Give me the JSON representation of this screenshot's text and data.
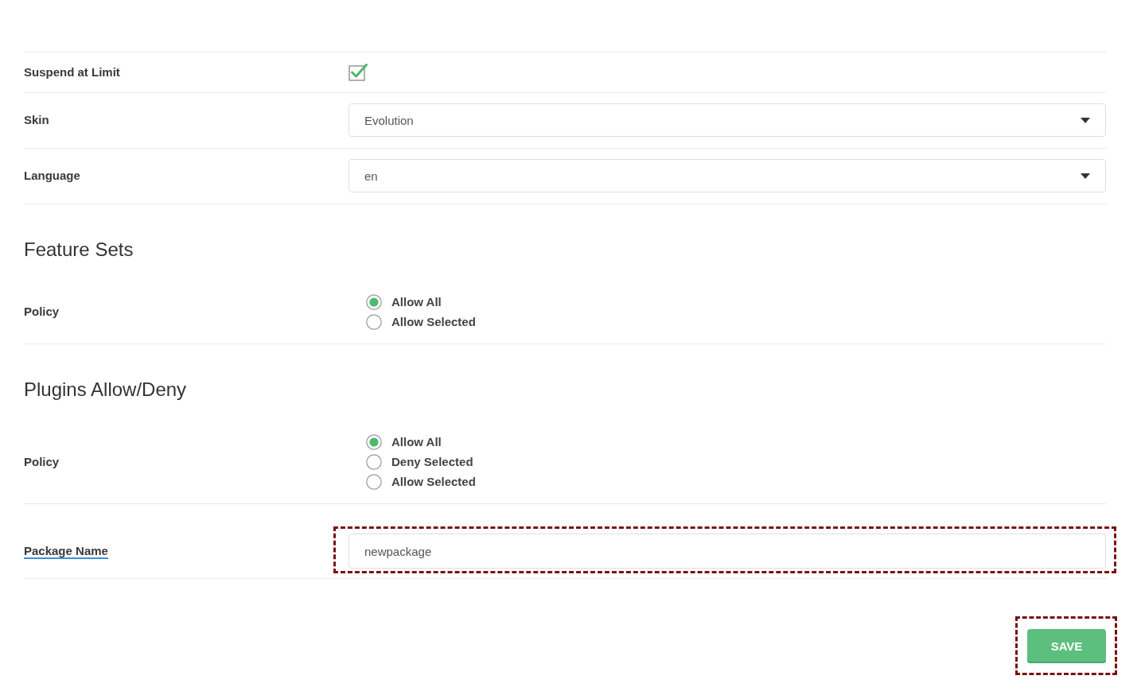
{
  "form": {
    "rows": [
      {
        "kind": "checkbox",
        "label": "Suspend at Limit",
        "help": false,
        "checked": true,
        "highlighted": false
      },
      {
        "kind": "select",
        "label": "Skin",
        "help": false,
        "value": "Evolution",
        "highlighted": false
      },
      {
        "kind": "select",
        "label": "Language",
        "help": false,
        "value": "en",
        "highlighted": false
      },
      {
        "kind": "heading",
        "title": "Feature Sets"
      },
      {
        "kind": "radio",
        "label": "Policy",
        "help": false,
        "highlighted": false,
        "options": [
          {
            "label": "Allow All",
            "selected": true
          },
          {
            "label": "Allow Selected",
            "selected": false
          }
        ]
      },
      {
        "kind": "heading",
        "title": "Plugins Allow/Deny"
      },
      {
        "kind": "radio",
        "label": "Policy",
        "help": false,
        "highlighted": false,
        "options": [
          {
            "label": "Allow All",
            "selected": true
          },
          {
            "label": "Deny Selected",
            "selected": false
          },
          {
            "label": "Allow Selected",
            "selected": false
          }
        ]
      },
      {
        "kind": "text",
        "label": "Package Name",
        "help": true,
        "value": "newpackage",
        "highlighted": true
      }
    ]
  },
  "save_button": {
    "label": "SAVE",
    "highlighted": true
  }
}
